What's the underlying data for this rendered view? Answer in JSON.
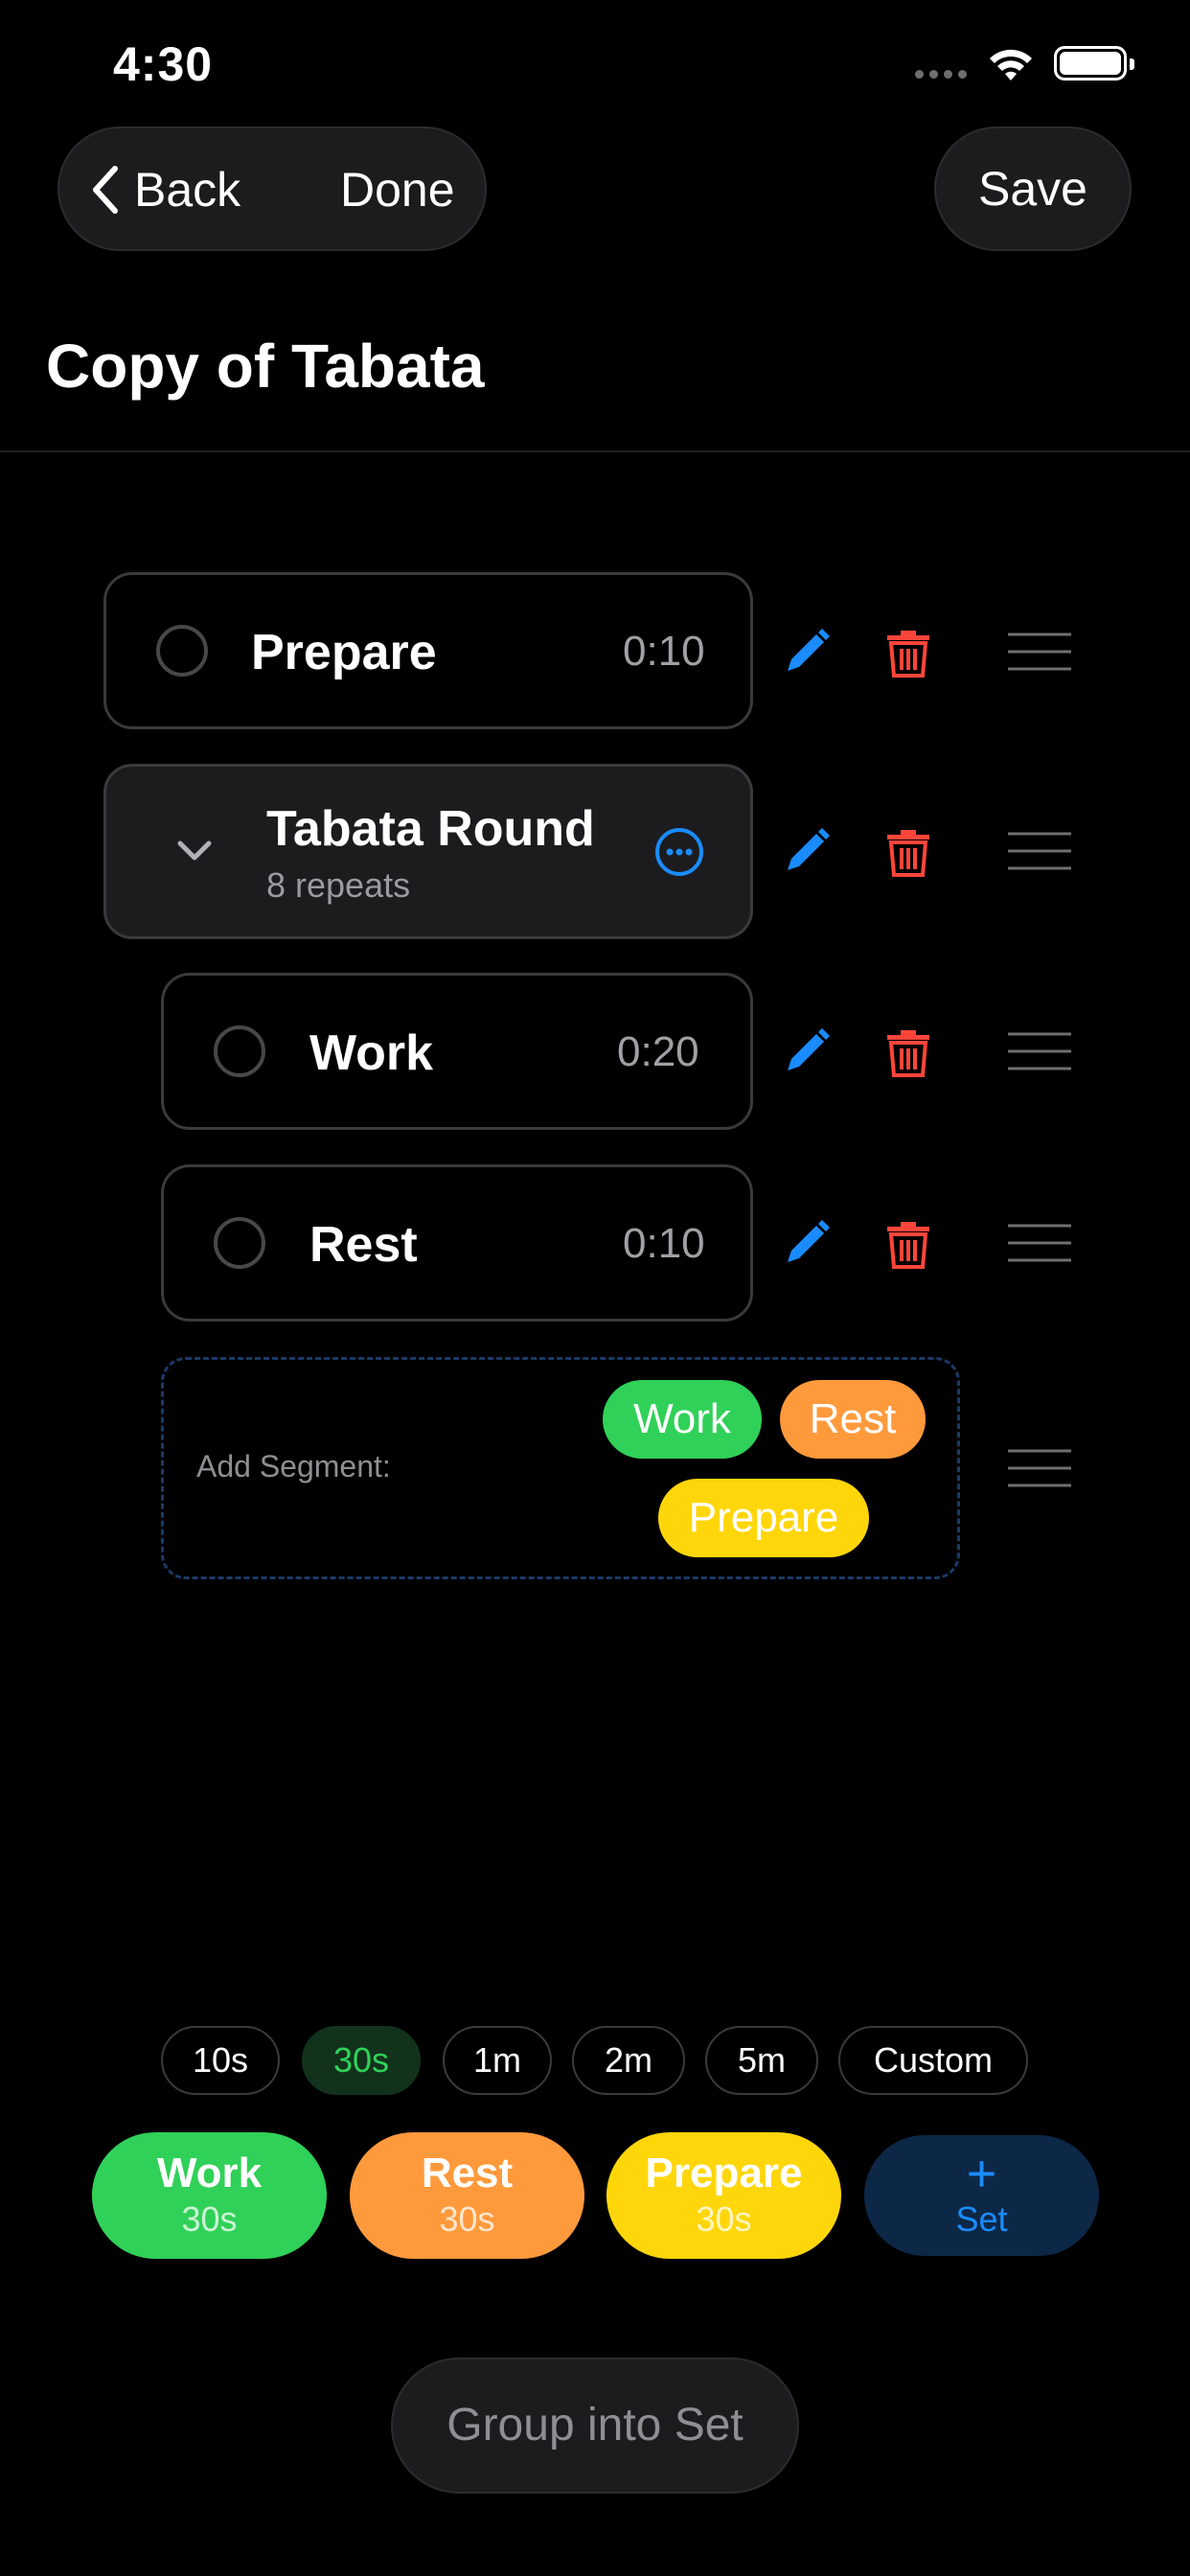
{
  "status_bar": {
    "time": "4:30"
  },
  "nav": {
    "back_label": "Back",
    "done_label": "Done",
    "save_label": "Save"
  },
  "page_title": "Copy of Tabata",
  "segments": [
    {
      "name": "Prepare",
      "duration": "0:10"
    },
    {
      "name": "Tabata Round",
      "subtitle": "8 repeats"
    },
    {
      "name": "Work",
      "duration": "0:20"
    },
    {
      "name": "Rest",
      "duration": "0:10"
    }
  ],
  "add_segment": {
    "label": "Add Segment:",
    "options": [
      "Work",
      "Rest",
      "Prepare"
    ]
  },
  "duration_chips": [
    "10s",
    "30s",
    "1m",
    "2m",
    "5m",
    "Custom"
  ],
  "selected_duration": "30s",
  "quick_add": [
    {
      "label": "Work",
      "value": "30s"
    },
    {
      "label": "Rest",
      "value": "30s"
    },
    {
      "label": "Prepare",
      "value": "30s"
    },
    {
      "label": "Set"
    }
  ],
  "group_button_label": "Group into Set",
  "colors": {
    "work": "#30d158",
    "rest": "#ff9a3c",
    "prepare": "#ffd60a",
    "accent": "#1a8cff",
    "delete": "#ff453a"
  }
}
